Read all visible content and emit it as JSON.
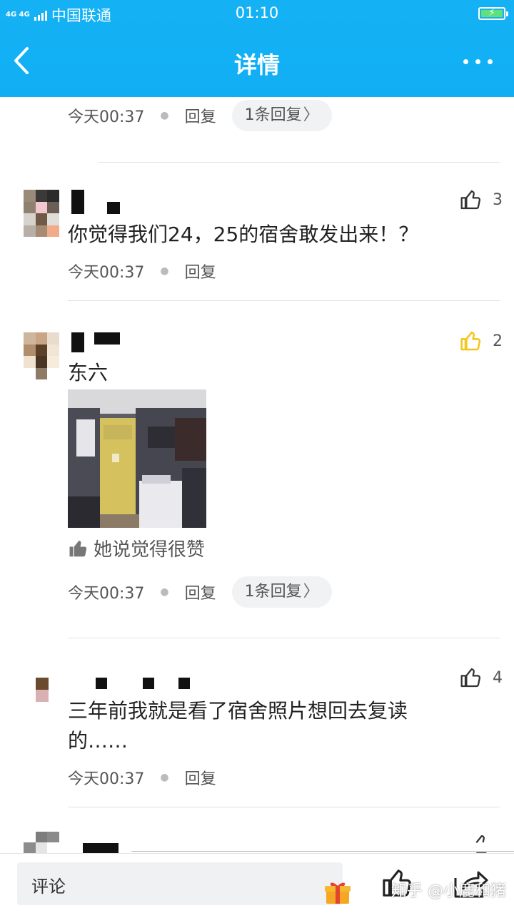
{
  "status": {
    "network": "4G 4G",
    "carrier": "中国联通",
    "time": "01:10"
  },
  "nav": {
    "title": "详情"
  },
  "comments": [
    {
      "time": "今天00:37",
      "reply_label": "回复",
      "replies_label": "1条回复"
    },
    {
      "text": "你觉得我们24，25的宿舍敢发出来！？",
      "likes": "3",
      "time": "今天00:37",
      "reply_label": "回复"
    },
    {
      "text": "东六",
      "likes": "2",
      "liked": true,
      "liked_note": "她说觉得很赞",
      "time": "今天00:37",
      "reply_label": "回复",
      "replies_label": "1条回复"
    },
    {
      "text_line1": "三年前我就是看了宿舍照片想回去复读",
      "text_line2": "的……",
      "likes": "4",
      "time": "今天00:37",
      "reply_label": "回复"
    }
  ],
  "bottom": {
    "comment_placeholder": "评论",
    "watermark": "知乎 @小鹿和猪"
  },
  "colors": {
    "header": "#14b2f5",
    "like_active": "#f5c518",
    "text": "#222222",
    "meta": "#555555"
  }
}
